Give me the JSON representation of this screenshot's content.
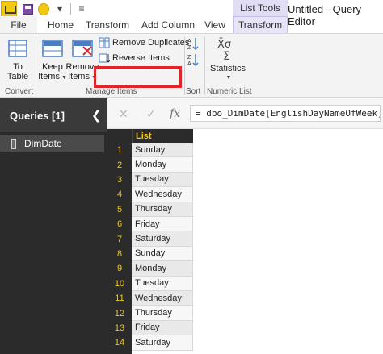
{
  "window": {
    "title": "Untitled - Query Editor",
    "context_group": "List Tools"
  },
  "tabs": [
    {
      "label": "File"
    },
    {
      "label": "Home"
    },
    {
      "label": "Transform"
    },
    {
      "label": "Add Column"
    },
    {
      "label": "View"
    },
    {
      "label": "Transform"
    }
  ],
  "ribbon": {
    "to_table": [
      "To",
      "Table"
    ],
    "keep_items": [
      "Keep",
      "Items"
    ],
    "remove_items": [
      "Remove",
      "Items"
    ],
    "remove_duplicates": "Remove Duplicates",
    "reverse_items": "Reverse Items",
    "statistics": "Statistics",
    "groups": {
      "convert": "Convert",
      "manage_items": "Manage Items",
      "sort": "Sort",
      "numeric_list": "Numeric List"
    },
    "highlight_color": "#e1232a"
  },
  "queries": {
    "title": "Queries [1]",
    "items": [
      "DimDate"
    ]
  },
  "formula": {
    "fx": "fx",
    "text": "= dbo_DimDate[EnglishDayNameOfWeek]"
  },
  "grid": {
    "column_header": "List",
    "rows": [
      {
        "n": "1",
        "v": "Sunday"
      },
      {
        "n": "2",
        "v": "Monday"
      },
      {
        "n": "3",
        "v": "Tuesday"
      },
      {
        "n": "4",
        "v": "Wednesday"
      },
      {
        "n": "5",
        "v": "Thursday"
      },
      {
        "n": "6",
        "v": "Friday"
      },
      {
        "n": "7",
        "v": "Saturday"
      },
      {
        "n": "8",
        "v": "Sunday"
      },
      {
        "n": "9",
        "v": "Monday"
      },
      {
        "n": "10",
        "v": "Tuesday"
      },
      {
        "n": "11",
        "v": "Wednesday"
      },
      {
        "n": "12",
        "v": "Thursday"
      },
      {
        "n": "13",
        "v": "Friday"
      },
      {
        "n": "14",
        "v": "Saturday"
      }
    ]
  },
  "colors": {
    "accent_yellow": "#f2c811",
    "context_tab": "#e1ddf5",
    "pane_dark": "#2b2b2b"
  },
  "icons": [
    "app-logo-icon",
    "save-icon",
    "smiley-icon",
    "undo-icon",
    "dropdown-icon",
    "table-icon",
    "keep-items-icon",
    "remove-items-icon",
    "remove-duplicates-icon",
    "reverse-items-icon",
    "sort-ascending-icon",
    "sort-descending-icon",
    "statistics-icon",
    "cancel-icon",
    "check-icon",
    "fx-icon",
    "chevron-left-icon"
  ]
}
